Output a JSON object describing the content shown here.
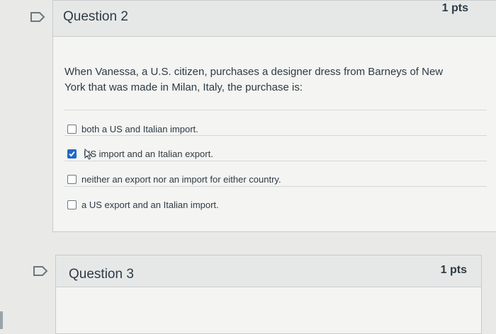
{
  "question2": {
    "title": "Question 2",
    "points": "1 pts",
    "text": "When Vanessa, a U.S. citizen, purchases a designer dress from Barneys of New York that was made in Milan, Italy, the purchase is:",
    "answers": [
      {
        "label": "both a US and Italian import.",
        "checked": false
      },
      {
        "label": "US import and an Italian export.",
        "checked": true
      },
      {
        "label": "neither an export nor an import for either country.",
        "checked": false
      },
      {
        "label": "a US export and an Italian import.",
        "checked": false
      }
    ]
  },
  "question3": {
    "title": "Question 3",
    "points": "1 pts"
  },
  "colors": {
    "checkbox_checked": "#2366c9",
    "card_bg": "#f4f4f2",
    "header_bg": "#e6e8e8"
  },
  "icons": {
    "flag": "flag-outline-icon",
    "check": "check-icon",
    "cursor": "mouse-pointer-icon"
  }
}
